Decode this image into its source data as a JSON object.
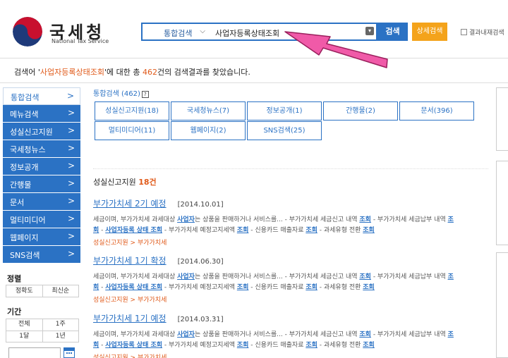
{
  "header": {
    "logo_title": "국세청",
    "logo_sub": "National Tax Service",
    "search_scope": "통합검색",
    "search_value": "사업자등록상태조회",
    "search_button": "검색",
    "detail_button": "상세검색",
    "within_label": "결과내재검색"
  },
  "summary": {
    "prefix": "검색어 '",
    "keyword": "사업자등록상태조회",
    "middle": "'에 대한 총 ",
    "count": "462",
    "suffix": "건의 검색결과를 찾았습니다."
  },
  "sidebar": {
    "items": [
      {
        "label": "통합검색",
        "arrow": ">"
      },
      {
        "label": "메뉴검색",
        "arrow": ">"
      },
      {
        "label": "성실신고지원",
        "arrow": ">"
      },
      {
        "label": "국세청뉴스",
        "arrow": ">"
      },
      {
        "label": "정보공개",
        "arrow": ">"
      },
      {
        "label": "간행물",
        "arrow": ">"
      },
      {
        "label": "문서",
        "arrow": ">"
      },
      {
        "label": "멀티미디어",
        "arrow": ">"
      },
      {
        "label": "웹페이지",
        "arrow": ">"
      },
      {
        "label": "SNS검색",
        "arrow": ">"
      }
    ],
    "sort_title": "정렬",
    "sort_options": [
      "정확도",
      "최신순"
    ],
    "period_title": "기간",
    "period_options": [
      [
        "전체",
        "1주"
      ],
      [
        "1달",
        "1년"
      ]
    ]
  },
  "main": {
    "tab_head": "통합검색 (462)",
    "tab_help": "?",
    "tabs": [
      "성실신고지원(18)",
      "국세청뉴스(7)",
      "정보공개(1)",
      "간행물(2)",
      "문서(396)",
      "멀티미디어(11)",
      "웹페이지(2)",
      "SNS검색(25)"
    ],
    "section_label": "성실신고지원",
    "section_count": "18건",
    "results": [
      {
        "title": "부가가치세 2기 예정",
        "date": "[2014.10.01]",
        "line1_a": "세금이며, 부가가치세 과세대상 ",
        "line1_b": "사업자",
        "line1_c": "는 상품을 판매하거나 서비스를... - 부가가치세 세금신고 내역 ",
        "line1_d": "조회",
        "line1_e": " - 부가가치세 세금납부 내역 ",
        "line1_f": "조",
        "line2_a": "회",
        "line2_b": " - ",
        "line2_c": "사업자등록 상태 조회",
        "line2_d": " - 부가가치세 예정고지세액 ",
        "line2_e": "조회",
        "line2_f": " - 신용카드 매출자료 ",
        "line2_g": "조회",
        "line2_h": " - 과세유형 전환 ",
        "line2_i": "조회",
        "crumb": "성실신고지원 > 부가가치세"
      },
      {
        "title": "부가가치세 1기 확정",
        "date": "[2014.06.30]",
        "line1_a": "세금이며, 부가가치세 과세대상 ",
        "line1_b": "사업자",
        "line1_c": "는 상품을 판매하거나 서비스를... - 부가가치세 세금신고 내역 ",
        "line1_d": "조회",
        "line1_e": " - 부가가치세 세금납부 내역 ",
        "line1_f": "조",
        "line2_a": "회",
        "line2_b": " - ",
        "line2_c": "사업자등록 상태 조회",
        "line2_d": " - 부가가치세 예정고지세액 ",
        "line2_e": "조회",
        "line2_f": " - 신용카드 매출자료 ",
        "line2_g": "조회",
        "line2_h": " - 과세유형 전환 ",
        "line2_i": "조회",
        "crumb": "성실신고지원 > 부가가치세"
      },
      {
        "title": "부가가치세 1기 예정",
        "date": "[2014.03.31]",
        "line1_a": "세금이며, 부가가치세 과세대상 ",
        "line1_b": "사업자",
        "line1_c": "는 상품을 판매하거나 서비스를... - 부가가치세 세금신고 내역 ",
        "line1_d": "조회",
        "line1_e": " - 부가가치세 세금납부 내역 ",
        "line1_f": "조",
        "line2_a": "회",
        "line2_b": " - ",
        "line2_c": "사업자등록 상태 조회",
        "line2_d": " - 부가가치세 예정고지세액 ",
        "line2_e": "조회",
        "line2_f": " - 신용카드 매출자료 ",
        "line2_g": "조회",
        "line2_h": " - 과세유형 전환 ",
        "line2_i": "조회",
        "crumb": "성실신고지원 > 부가가치세"
      }
    ]
  },
  "colors": {
    "primary": "#2b72c4",
    "accent_orange": "#f4a31b",
    "highlight": "#e05a1a",
    "arrow_pink": "#f05aa8"
  }
}
